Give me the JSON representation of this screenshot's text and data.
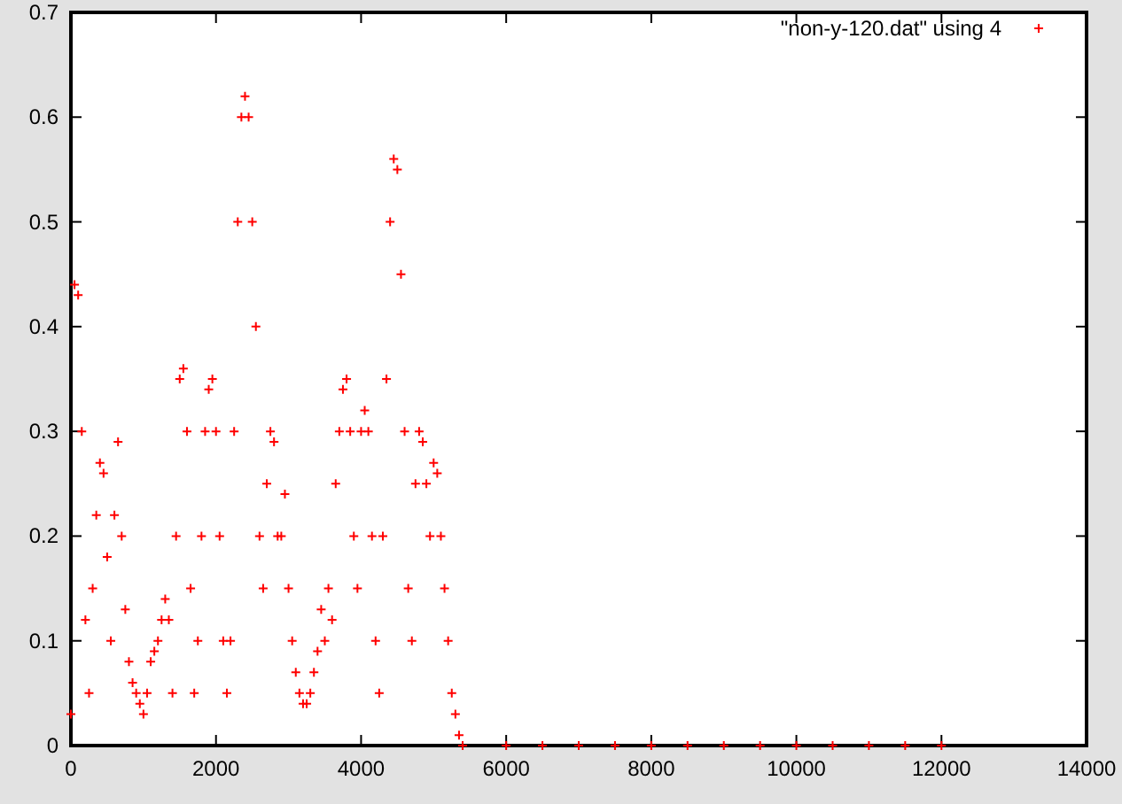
{
  "chart_data": {
    "type": "scatter",
    "xlim": [
      0,
      14000
    ],
    "ylim": [
      0,
      0.7
    ],
    "xticks": [
      0,
      2000,
      4000,
      6000,
      8000,
      10000,
      12000,
      14000
    ],
    "yticks": [
      {
        "value": 0,
        "label": "0"
      },
      {
        "value": 0.1,
        "label": "0.1"
      },
      {
        "value": 0.2,
        "label": "0.2"
      },
      {
        "value": 0.3,
        "label": "0.3"
      },
      {
        "value": 0.4,
        "label": "0.4"
      },
      {
        "value": 0.5,
        "label": "0.5"
      },
      {
        "value": 0.6,
        "label": "0.6"
      },
      {
        "value": 0.7,
        "label": "0.7"
      }
    ],
    "x": [
      0,
      50,
      100,
      150,
      200,
      250,
      300,
      350,
      400,
      450,
      500,
      550,
      600,
      650,
      700,
      750,
      800,
      850,
      900,
      950,
      1000,
      1050,
      1100,
      1150,
      1200,
      1250,
      1300,
      1350,
      1400,
      1450,
      1500,
      1550,
      1600,
      1650,
      1700,
      1750,
      1800,
      1850,
      1900,
      1950,
      2000,
      2050,
      2100,
      2150,
      2200,
      2250,
      2300,
      2350,
      2400,
      2450,
      2500,
      2550,
      2600,
      2650,
      2700,
      2750,
      2800,
      2850,
      2900,
      2950,
      3000,
      3050,
      3100,
      3150,
      3200,
      3250,
      3300,
      3350,
      3400,
      3450,
      3500,
      3550,
      3600,
      3650,
      3700,
      3750,
      3800,
      3850,
      3900,
      3950,
      4000,
      4050,
      4100,
      4150,
      4200,
      4250,
      4300,
      4350,
      4400,
      4450,
      4500,
      4550,
      4600,
      4650,
      4700,
      4750,
      4800,
      4850,
      4900,
      4950,
      5000,
      5050,
      5100,
      5150,
      5200,
      5250,
      5300,
      5350,
      5400,
      6000,
      6500,
      7000,
      7500,
      8000,
      8500,
      9000,
      9500,
      10000,
      10500,
      11000,
      11500,
      12000
    ],
    "series": [
      {
        "name": "\"non-y-120.dat\" using 4",
        "color": "#ff0000",
        "values": [
          0.03,
          0.44,
          0.43,
          0.3,
          0.12,
          0.05,
          0.15,
          0.22,
          0.27,
          0.26,
          0.18,
          0.1,
          0.22,
          0.29,
          0.2,
          0.13,
          0.08,
          0.06,
          0.05,
          0.04,
          0.03,
          0.05,
          0.08,
          0.09,
          0.1,
          0.12,
          0.14,
          0.12,
          0.05,
          0.2,
          0.35,
          0.36,
          0.3,
          0.15,
          0.05,
          0.1,
          0.2,
          0.3,
          0.34,
          0.35,
          0.3,
          0.2,
          0.1,
          0.05,
          0.1,
          0.3,
          0.5,
          0.6,
          0.62,
          0.6,
          0.5,
          0.4,
          0.2,
          0.15,
          0.25,
          0.3,
          0.29,
          0.2,
          0.2,
          0.24,
          0.15,
          0.1,
          0.07,
          0.05,
          0.04,
          0.04,
          0.05,
          0.07,
          0.09,
          0.13,
          0.1,
          0.15,
          0.12,
          0.25,
          0.3,
          0.34,
          0.35,
          0.3,
          0.2,
          0.15,
          0.3,
          0.32,
          0.3,
          0.2,
          0.1,
          0.05,
          0.2,
          0.35,
          0.5,
          0.56,
          0.55,
          0.45,
          0.3,
          0.15,
          0.1,
          0.25,
          0.3,
          0.29,
          0.25,
          0.2,
          0.27,
          0.26,
          0.2,
          0.15,
          0.1,
          0.05,
          0.03,
          0.01,
          0,
          0,
          0,
          0,
          0,
          0,
          0,
          0,
          0,
          0,
          0,
          0,
          0,
          0
        ]
      }
    ]
  }
}
